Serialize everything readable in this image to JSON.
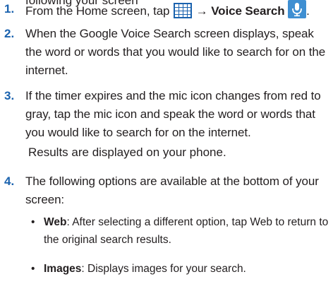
{
  "cutoff_top_text": "following your screen",
  "steps": [
    {
      "number": "1.",
      "prefix": "From the Home screen, tap",
      "arrow": "→",
      "bold_label": "Voice Search",
      "suffix": "."
    },
    {
      "number": "2.",
      "text": "When the Google Voice Search screen displays, speak the word or words that you would like to search for on the internet."
    },
    {
      "number": "3.",
      "text": "If the timer expires and the mic icon changes from red to gray, tap the mic icon and speak the word or words that you would like to search for on the internet.",
      "result": "Results are displayed on your phone."
    },
    {
      "number": "4.",
      "text": "The following options are available at the bottom of your screen:",
      "bullets": [
        {
          "bold": "Web",
          "text": ": After selecting a different option, tap Web to return to the original search results."
        },
        {
          "bold": "Images",
          "text": ": Displays images for your search."
        }
      ]
    }
  ],
  "colors": {
    "step_number": "#1a62ae",
    "apps_icon": "#1a62ae",
    "mic_icon_bg": "#3f8fd2",
    "text": "#231f20"
  },
  "icons": {
    "apps": "apps-grid-icon",
    "mic": "mic-icon"
  }
}
